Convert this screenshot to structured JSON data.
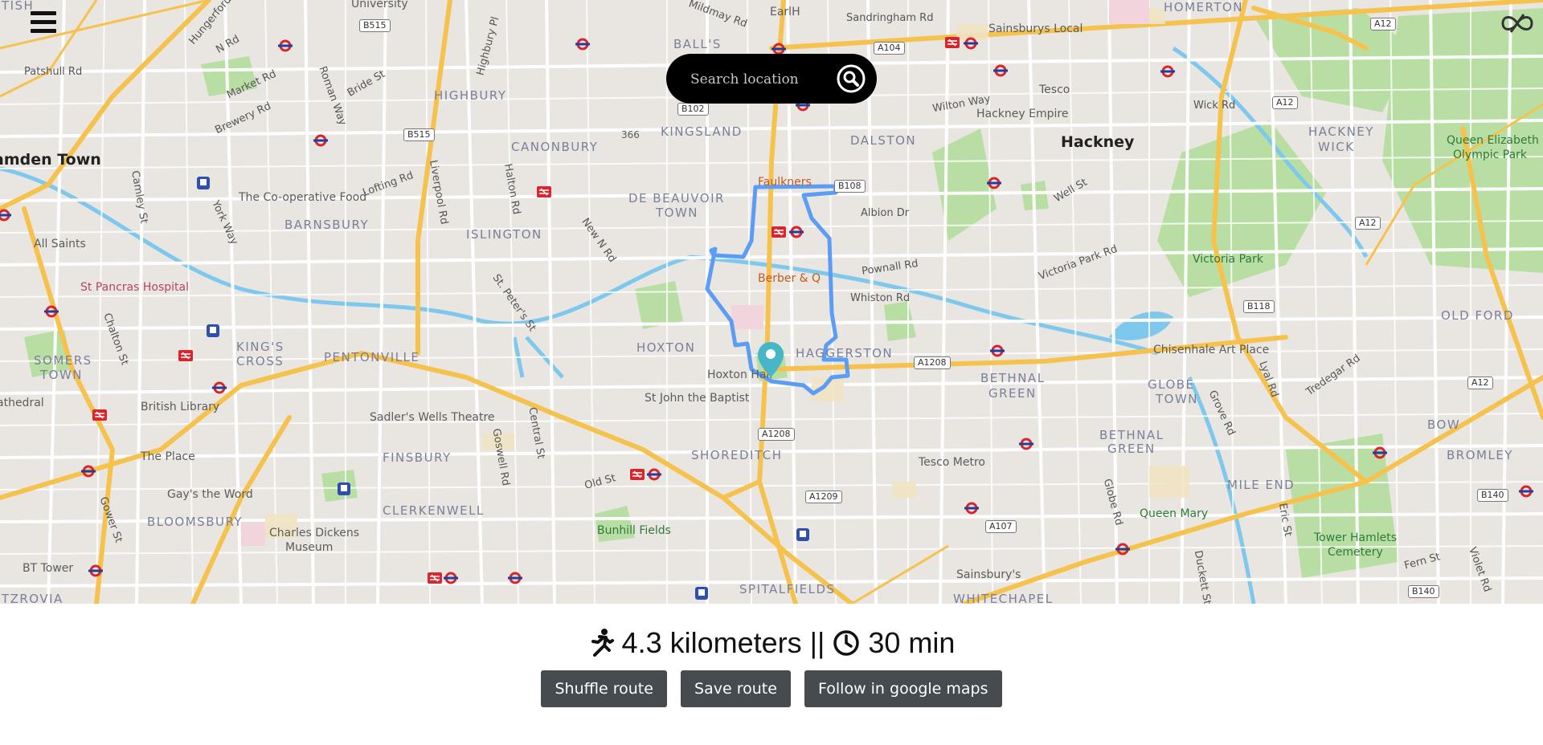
{
  "header": {
    "menu_icon": "hamburger-menu-icon",
    "logo_icon": "infinity-loop-logo-icon"
  },
  "search": {
    "placeholder": "Search location",
    "icon": "search-icon"
  },
  "map": {
    "areas": [
      "HIGHBURY",
      "KINGSLAND",
      "CANONBURY",
      "DALSTON",
      "DE BEAUVOIR",
      "TOWN",
      "BARNSBURY",
      "ISLINGTON",
      "HOXTON",
      "HAGGERSTON",
      "KING'S",
      "CROSS",
      "PENTONVILLE",
      "SOMERS",
      "TOWN",
      "FINSBURY",
      "CLERKENWELL",
      "SHOREDITCH",
      "BLOOMSBURY",
      "SPITALFIELDS",
      "BETHNAL",
      "GREEN",
      "GLOBE",
      "TOWN",
      "MILE END",
      "BOW",
      "BROMLEY",
      "OLD FORD",
      "HACKNEY",
      "WICK",
      "HOMERTON",
      "BALL'S",
      "BETHNAL",
      "GREEN",
      "WHITECHAPEL",
      "ITZROVIA"
    ],
    "places": [
      "amden Town",
      "Hackney",
      "University",
      "EarlH",
      "Sandringham Rd",
      "Sainsburys Local",
      "Tesco",
      "Hackney Empire",
      "Wick Rd",
      "Queen Elizabeth",
      "Olympic Park",
      "Victoria Park",
      "Chisenhale Art Place",
      "Queen Mary",
      "Tower Hamlets",
      "Cemetery",
      "Sainsbury's",
      "Tesco Metro",
      "Bunhill Fields",
      "Charles Dickens",
      "Museum",
      "BT Tower",
      "Gay's the Word",
      "The Place",
      "British Library",
      "Sadler's Wells Theatre",
      "St Pancras Hospital",
      "All Saints",
      "The Co-operative Food",
      "Faulkners",
      "Berber & Q",
      "Hoxton Hall",
      "St John the Baptist",
      "athedral",
      "366"
    ],
    "roads": [
      "N Rd",
      "Market Rd",
      "Brewery Rd",
      "Patshull Rd",
      "Roman Way",
      "Bride St",
      "Hungerford",
      "Lofting Rd",
      "Liverpool Rd",
      "Halton Rd",
      "New N Rd",
      "St. Peter's St",
      "Camley St",
      "York Way",
      "Chalton St",
      "Goswell Rd",
      "Central St",
      "Old St",
      "Gower St",
      "Albion Dr",
      "Pownall Rd",
      "Whiston Rd",
      "Well St",
      "Victoria Park Rd",
      "Wilton Way",
      "Globe Rd",
      "Grove Rd",
      "Lyal Rd",
      "Tredegar Rd",
      "Eric St",
      "Duckett St",
      "Fern St",
      "Violet Rd",
      "Highbury Pl",
      "Mildmay Rd",
      "ITISH"
    ],
    "shields": [
      "B515",
      "B515",
      "B102",
      "A104",
      "A12",
      "A12",
      "A12",
      "B108",
      "A1208",
      "B118",
      "A12",
      "A1208",
      "A1209",
      "A107",
      "B140",
      "B140"
    ]
  },
  "route": {
    "distance": "4.3 kilometers",
    "separator": "||",
    "duration": "30 min",
    "distance_icon": "running-person-icon",
    "duration_icon": "clock-icon",
    "color": "#5b9cf5"
  },
  "buttons": {
    "shuffle": "Shuffle route",
    "save": "Save route",
    "follow": "Follow in google maps"
  },
  "colors": {
    "button_bg": "#454b4f",
    "map_bg": "#e9e6e1",
    "park": "#b7dda0",
    "water": "#7ec8ee",
    "major_road": "#f6c24e"
  }
}
